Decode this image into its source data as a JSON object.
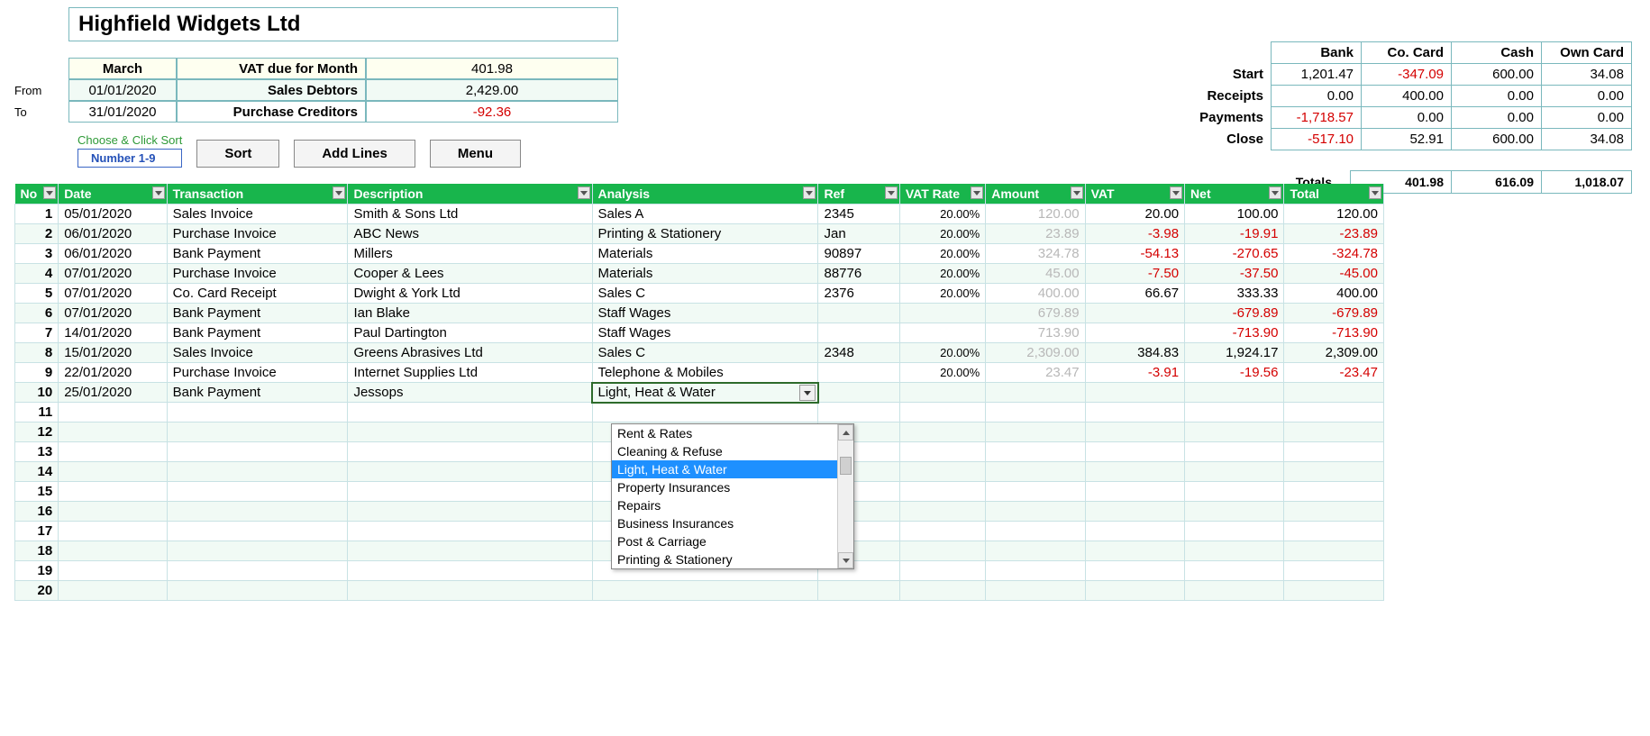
{
  "company": "Highfield Widgets Ltd",
  "from_label": "From",
  "to_label": "To",
  "header": {
    "month": "March",
    "vat_due_label": "VAT due for Month",
    "vat_due": "401.98",
    "from_date": "01/01/2020",
    "sales_debtors_label": "Sales Debtors",
    "sales_debtors": "2,429.00",
    "to_date": "31/01/2020",
    "purchase_creditors_label": "Purchase Creditors",
    "purchase_creditors": "-92.36"
  },
  "summary": {
    "cols": [
      "Bank",
      "Co. Card",
      "Cash",
      "Own Card"
    ],
    "rows": [
      {
        "label": "Start",
        "vals": [
          "1,201.47",
          "-347.09",
          "600.00",
          "34.08"
        ],
        "neg": [
          false,
          true,
          false,
          false
        ]
      },
      {
        "label": "Receipts",
        "vals": [
          "0.00",
          "400.00",
          "0.00",
          "0.00"
        ],
        "neg": [
          false,
          false,
          false,
          false
        ]
      },
      {
        "label": "Payments",
        "vals": [
          "-1,718.57",
          "0.00",
          "0.00",
          "0.00"
        ],
        "neg": [
          true,
          false,
          false,
          false
        ]
      },
      {
        "label": "Close",
        "vals": [
          "-517.10",
          "52.91",
          "600.00",
          "34.08"
        ],
        "neg": [
          true,
          false,
          false,
          false
        ]
      }
    ],
    "totals_label": "Totals",
    "totals": [
      "401.98",
      "616.09",
      "1,018.07"
    ]
  },
  "sort_area": {
    "choose_label": "Choose & Click Sort",
    "pill": "Number  1-9",
    "sort_btn": "Sort",
    "add_btn": "Add Lines",
    "menu_btn": "Menu"
  },
  "columns": [
    "No",
    "Date",
    "Transaction",
    "Description",
    "Analysis",
    "Ref",
    "VAT Rate",
    "Amount",
    "VAT",
    "Net",
    "Total"
  ],
  "rows": [
    {
      "no": "1",
      "date": "05/01/2020",
      "trans": "Sales Invoice",
      "desc": "Smith & Sons Ltd",
      "analysis": "Sales A",
      "ref": "2345",
      "vatrate": "20.00%",
      "amount": "120.00",
      "vat": "20.00",
      "net": "100.00",
      "total": "120.00",
      "negFlags": {
        "vat": false,
        "net": false,
        "total": false
      }
    },
    {
      "no": "2",
      "date": "06/01/2020",
      "trans": "Purchase Invoice",
      "desc": "ABC News",
      "analysis": "Printing & Stationery",
      "ref": "Jan",
      "vatrate": "20.00%",
      "amount": "23.89",
      "vat": "-3.98",
      "net": "-19.91",
      "total": "-23.89",
      "negFlags": {
        "vat": true,
        "net": true,
        "total": true
      }
    },
    {
      "no": "3",
      "date": "06/01/2020",
      "trans": "Bank Payment",
      "desc": "Millers",
      "analysis": "Materials",
      "ref": "90897",
      "vatrate": "20.00%",
      "amount": "324.78",
      "vat": "-54.13",
      "net": "-270.65",
      "total": "-324.78",
      "negFlags": {
        "vat": true,
        "net": true,
        "total": true
      }
    },
    {
      "no": "4",
      "date": "07/01/2020",
      "trans": "Purchase Invoice",
      "desc": "Cooper & Lees",
      "analysis": "Materials",
      "ref": "88776",
      "vatrate": "20.00%",
      "amount": "45.00",
      "vat": "-7.50",
      "net": "-37.50",
      "total": "-45.00",
      "negFlags": {
        "vat": true,
        "net": true,
        "total": true
      }
    },
    {
      "no": "5",
      "date": "07/01/2020",
      "trans": "Co. Card Receipt",
      "desc": "Dwight & York Ltd",
      "analysis": "Sales C",
      "ref": "2376",
      "vatrate": "20.00%",
      "amount": "400.00",
      "vat": "66.67",
      "net": "333.33",
      "total": "400.00",
      "negFlags": {
        "vat": false,
        "net": false,
        "total": false
      }
    },
    {
      "no": "6",
      "date": "07/01/2020",
      "trans": "Bank Payment",
      "desc": "Ian Blake",
      "analysis": "Staff Wages",
      "ref": "",
      "vatrate": "",
      "amount": "679.89",
      "vat": "",
      "net": "-679.89",
      "total": "-679.89",
      "negFlags": {
        "vat": false,
        "net": true,
        "total": true
      }
    },
    {
      "no": "7",
      "date": "14/01/2020",
      "trans": "Bank Payment",
      "desc": "Paul Dartington",
      "analysis": "Staff Wages",
      "ref": "",
      "vatrate": "",
      "amount": "713.90",
      "vat": "",
      "net": "-713.90",
      "total": "-713.90",
      "negFlags": {
        "vat": false,
        "net": true,
        "total": true
      }
    },
    {
      "no": "8",
      "date": "15/01/2020",
      "trans": "Sales Invoice",
      "desc": "Greens Abrasives Ltd",
      "analysis": "Sales C",
      "ref": "2348",
      "vatrate": "20.00%",
      "amount": "2,309.00",
      "vat": "384.83",
      "net": "1,924.17",
      "total": "2,309.00",
      "negFlags": {
        "vat": false,
        "net": false,
        "total": false
      }
    },
    {
      "no": "9",
      "date": "22/01/2020",
      "trans": "Purchase Invoice",
      "desc": "Internet Supplies Ltd",
      "analysis": "Telephone & Mobiles",
      "ref": "",
      "vatrate": "20.00%",
      "amount": "23.47",
      "vat": "-3.91",
      "net": "-19.56",
      "total": "-23.47",
      "negFlags": {
        "vat": true,
        "net": true,
        "total": true
      }
    },
    {
      "no": "10",
      "date": "25/01/2020",
      "trans": "Bank Payment",
      "desc": "Jessops",
      "analysis": "Light, Heat & Water",
      "ref": "",
      "vatrate": "",
      "amount": "",
      "vat": "",
      "net": "",
      "total": "",
      "negFlags": {
        "vat": false,
        "net": false,
        "total": false
      },
      "active": true
    }
  ],
  "empty_rows": [
    "11",
    "12",
    "13",
    "14",
    "15",
    "16",
    "17",
    "18",
    "19",
    "20"
  ],
  "dropdown": {
    "items": [
      "Rent & Rates",
      "Cleaning & Refuse",
      "Light, Heat & Water",
      "Property Insurances",
      "Repairs",
      "Business Insurances",
      "Post & Carriage",
      "Printing & Stationery"
    ],
    "selected_index": 2
  }
}
